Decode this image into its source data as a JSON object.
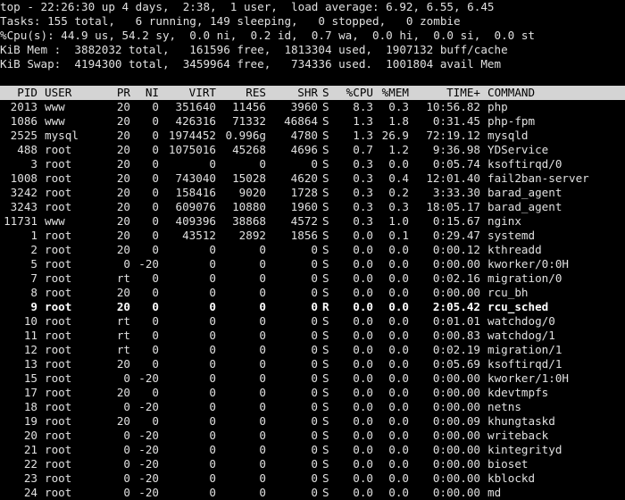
{
  "summary": {
    "line1": "top - 22:26:30 up 4 days,  2:38,  1 user,  load average: 6.92, 6.55, 6.45",
    "line2": "Tasks: 155 total,   6 running, 149 sleeping,   0 stopped,   0 zombie",
    "line3": "%Cpu(s): 44.9 us, 54.2 sy,  0.0 ni,  0.2 id,  0.7 wa,  0.0 hi,  0.0 si,  0.0 st",
    "line4": "KiB Mem :  3882032 total,   161596 free,  1813304 used,  1907132 buff/cache",
    "line5": "KiB Swap:  4194300 total,  3459964 free,   734336 used.  1001804 avail Mem"
  },
  "columns": {
    "pid": "PID",
    "user": "USER",
    "pr": "PR",
    "ni": "NI",
    "virt": "VIRT",
    "res": "RES",
    "shr": "SHR",
    "s": "S",
    "cpu": "%CPU",
    "mem": "%MEM",
    "time": "TIME+",
    "command": "COMMAND"
  },
  "processes": [
    {
      "pid": "2013",
      "user": "www",
      "pr": "20",
      "ni": "0",
      "virt": "351640",
      "res": "11456",
      "shr": "3960",
      "s": "S",
      "cpu": "8.3",
      "mem": "0.3",
      "time": "10:56.82",
      "command": "php"
    },
    {
      "pid": "1086",
      "user": "www",
      "pr": "20",
      "ni": "0",
      "virt": "426316",
      "res": "71332",
      "shr": "46864",
      "s": "S",
      "cpu": "1.3",
      "mem": "1.8",
      "time": "0:31.45",
      "command": "php-fpm"
    },
    {
      "pid": "2525",
      "user": "mysql",
      "pr": "20",
      "ni": "0",
      "virt": "1974452",
      "res": "0.996g",
      "shr": "4780",
      "s": "S",
      "cpu": "1.3",
      "mem": "26.9",
      "time": "72:19.12",
      "command": "mysqld"
    },
    {
      "pid": "488",
      "user": "root",
      "pr": "20",
      "ni": "0",
      "virt": "1075016",
      "res": "45268",
      "shr": "4696",
      "s": "S",
      "cpu": "0.7",
      "mem": "1.2",
      "time": "9:36.98",
      "command": "YDService"
    },
    {
      "pid": "3",
      "user": "root",
      "pr": "20",
      "ni": "0",
      "virt": "0",
      "res": "0",
      "shr": "0",
      "s": "S",
      "cpu": "0.3",
      "mem": "0.0",
      "time": "0:05.74",
      "command": "ksoftirqd/0"
    },
    {
      "pid": "1008",
      "user": "root",
      "pr": "20",
      "ni": "0",
      "virt": "743040",
      "res": "15028",
      "shr": "4620",
      "s": "S",
      "cpu": "0.3",
      "mem": "0.4",
      "time": "12:01.40",
      "command": "fail2ban-server"
    },
    {
      "pid": "3242",
      "user": "root",
      "pr": "20",
      "ni": "0",
      "virt": "158416",
      "res": "9020",
      "shr": "1728",
      "s": "S",
      "cpu": "0.3",
      "mem": "0.2",
      "time": "3:33.30",
      "command": "barad_agent"
    },
    {
      "pid": "3243",
      "user": "root",
      "pr": "20",
      "ni": "0",
      "virt": "609076",
      "res": "10880",
      "shr": "1960",
      "s": "S",
      "cpu": "0.3",
      "mem": "0.3",
      "time": "18:05.17",
      "command": "barad_agent"
    },
    {
      "pid": "11731",
      "user": "www",
      "pr": "20",
      "ni": "0",
      "virt": "409396",
      "res": "38868",
      "shr": "4572",
      "s": "S",
      "cpu": "0.3",
      "mem": "1.0",
      "time": "0:15.67",
      "command": "nginx"
    },
    {
      "pid": "1",
      "user": "root",
      "pr": "20",
      "ni": "0",
      "virt": "43512",
      "res": "2892",
      "shr": "1856",
      "s": "S",
      "cpu": "0.0",
      "mem": "0.1",
      "time": "0:29.47",
      "command": "systemd"
    },
    {
      "pid": "2",
      "user": "root",
      "pr": "20",
      "ni": "0",
      "virt": "0",
      "res": "0",
      "shr": "0",
      "s": "S",
      "cpu": "0.0",
      "mem": "0.0",
      "time": "0:00.12",
      "command": "kthreadd"
    },
    {
      "pid": "5",
      "user": "root",
      "pr": "0",
      "ni": "-20",
      "virt": "0",
      "res": "0",
      "shr": "0",
      "s": "S",
      "cpu": "0.0",
      "mem": "0.0",
      "time": "0:00.00",
      "command": "kworker/0:0H"
    },
    {
      "pid": "7",
      "user": "root",
      "pr": "rt",
      "ni": "0",
      "virt": "0",
      "res": "0",
      "shr": "0",
      "s": "S",
      "cpu": "0.0",
      "mem": "0.0",
      "time": "0:02.16",
      "command": "migration/0"
    },
    {
      "pid": "8",
      "user": "root",
      "pr": "20",
      "ni": "0",
      "virt": "0",
      "res": "0",
      "shr": "0",
      "s": "S",
      "cpu": "0.0",
      "mem": "0.0",
      "time": "0:00.00",
      "command": "rcu_bh"
    },
    {
      "pid": "9",
      "user": "root",
      "pr": "20",
      "ni": "0",
      "virt": "0",
      "res": "0",
      "shr": "0",
      "s": "R",
      "cpu": "0.0",
      "mem": "0.0",
      "time": "2:05.42",
      "command": "rcu_sched"
    },
    {
      "pid": "10",
      "user": "root",
      "pr": "rt",
      "ni": "0",
      "virt": "0",
      "res": "0",
      "shr": "0",
      "s": "S",
      "cpu": "0.0",
      "mem": "0.0",
      "time": "0:01.01",
      "command": "watchdog/0"
    },
    {
      "pid": "11",
      "user": "root",
      "pr": "rt",
      "ni": "0",
      "virt": "0",
      "res": "0",
      "shr": "0",
      "s": "S",
      "cpu": "0.0",
      "mem": "0.0",
      "time": "0:00.83",
      "command": "watchdog/1"
    },
    {
      "pid": "12",
      "user": "root",
      "pr": "rt",
      "ni": "0",
      "virt": "0",
      "res": "0",
      "shr": "0",
      "s": "S",
      "cpu": "0.0",
      "mem": "0.0",
      "time": "0:02.19",
      "command": "migration/1"
    },
    {
      "pid": "13",
      "user": "root",
      "pr": "20",
      "ni": "0",
      "virt": "0",
      "res": "0",
      "shr": "0",
      "s": "S",
      "cpu": "0.0",
      "mem": "0.0",
      "time": "0:05.69",
      "command": "ksoftirqd/1"
    },
    {
      "pid": "15",
      "user": "root",
      "pr": "0",
      "ni": "-20",
      "virt": "0",
      "res": "0",
      "shr": "0",
      "s": "S",
      "cpu": "0.0",
      "mem": "0.0",
      "time": "0:00.00",
      "command": "kworker/1:0H"
    },
    {
      "pid": "17",
      "user": "root",
      "pr": "20",
      "ni": "0",
      "virt": "0",
      "res": "0",
      "shr": "0",
      "s": "S",
      "cpu": "0.0",
      "mem": "0.0",
      "time": "0:00.00",
      "command": "kdevtmpfs"
    },
    {
      "pid": "18",
      "user": "root",
      "pr": "0",
      "ni": "-20",
      "virt": "0",
      "res": "0",
      "shr": "0",
      "s": "S",
      "cpu": "0.0",
      "mem": "0.0",
      "time": "0:00.00",
      "command": "netns"
    },
    {
      "pid": "19",
      "user": "root",
      "pr": "20",
      "ni": "0",
      "virt": "0",
      "res": "0",
      "shr": "0",
      "s": "S",
      "cpu": "0.0",
      "mem": "0.0",
      "time": "0:00.09",
      "command": "khungtaskd"
    },
    {
      "pid": "20",
      "user": "root",
      "pr": "0",
      "ni": "-20",
      "virt": "0",
      "res": "0",
      "shr": "0",
      "s": "S",
      "cpu": "0.0",
      "mem": "0.0",
      "time": "0:00.00",
      "command": "writeback"
    },
    {
      "pid": "21",
      "user": "root",
      "pr": "0",
      "ni": "-20",
      "virt": "0",
      "res": "0",
      "shr": "0",
      "s": "S",
      "cpu": "0.0",
      "mem": "0.0",
      "time": "0:00.00",
      "command": "kintegrityd"
    },
    {
      "pid": "22",
      "user": "root",
      "pr": "0",
      "ni": "-20",
      "virt": "0",
      "res": "0",
      "shr": "0",
      "s": "S",
      "cpu": "0.0",
      "mem": "0.0",
      "time": "0:00.00",
      "command": "bioset"
    },
    {
      "pid": "23",
      "user": "root",
      "pr": "0",
      "ni": "-20",
      "virt": "0",
      "res": "0",
      "shr": "0",
      "s": "S",
      "cpu": "0.0",
      "mem": "0.0",
      "time": "0:00.00",
      "command": "kblockd"
    },
    {
      "pid": "24",
      "user": "root",
      "pr": "0",
      "ni": "-20",
      "virt": "0",
      "res": "0",
      "shr": "0",
      "s": "S",
      "cpu": "0.0",
      "mem": "0.0",
      "time": "0:00.00",
      "command": "md"
    }
  ],
  "colors": {
    "background": "#000000",
    "text": "#e0e0e0",
    "header_bg": "#d4d4d4",
    "header_text": "#000000",
    "highlight_text": "#ffffff"
  }
}
